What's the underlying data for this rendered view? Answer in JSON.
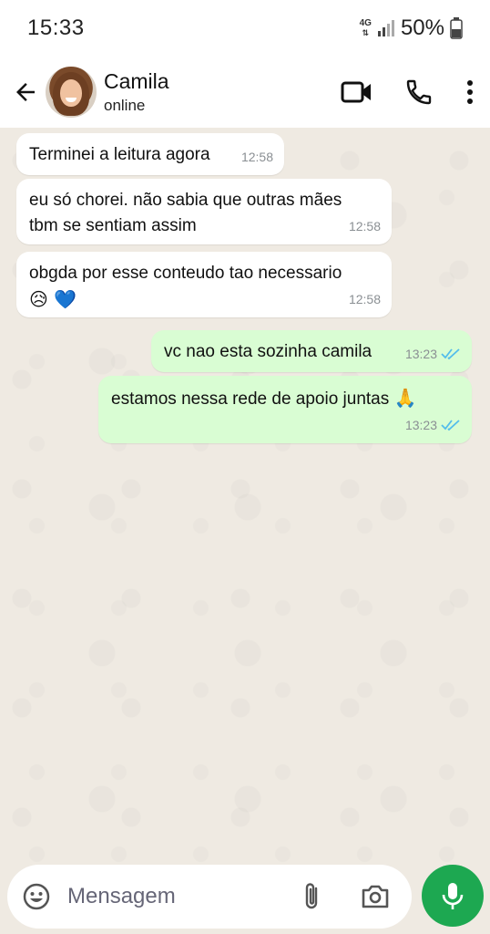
{
  "status_bar": {
    "time": "15:33",
    "network": "4G",
    "battery": "50%"
  },
  "header": {
    "contact_name": "Camila",
    "contact_status": "online"
  },
  "messages": [
    {
      "direction": "in",
      "text": "Terminei a leitura agora",
      "time": "12:58"
    },
    {
      "direction": "in",
      "text_line1": "eu só chorei. não sabia que outras mães",
      "text_line2": "tbm se sentiam assim",
      "time": "12:58"
    },
    {
      "direction": "in",
      "text": "obgda por esse conteudo tao necessario",
      "emojis": "😥 💙",
      "time": "12:58"
    },
    {
      "direction": "out",
      "text": "vc nao esta sozinha camila",
      "time": "13:23",
      "read": true
    },
    {
      "direction": "out",
      "text": "estamos nessa rede de apoio juntas",
      "emoji": "🙏",
      "time": "13:23",
      "read": true
    }
  ],
  "input": {
    "placeholder": "Mensagem"
  },
  "icons": {
    "back": "back-arrow-icon",
    "video": "video-call-icon",
    "phone": "phone-icon",
    "menu": "more-vert-icon",
    "emoji": "emoji-icon",
    "attach": "paperclip-icon",
    "camera": "camera-icon",
    "mic": "mic-icon"
  },
  "colors": {
    "chat_bg": "#efeae2",
    "outgoing_bubble": "#d9fdd3",
    "incoming_bubble": "#ffffff",
    "mic_button": "#1da851",
    "read_ticks": "#53bdeb"
  }
}
